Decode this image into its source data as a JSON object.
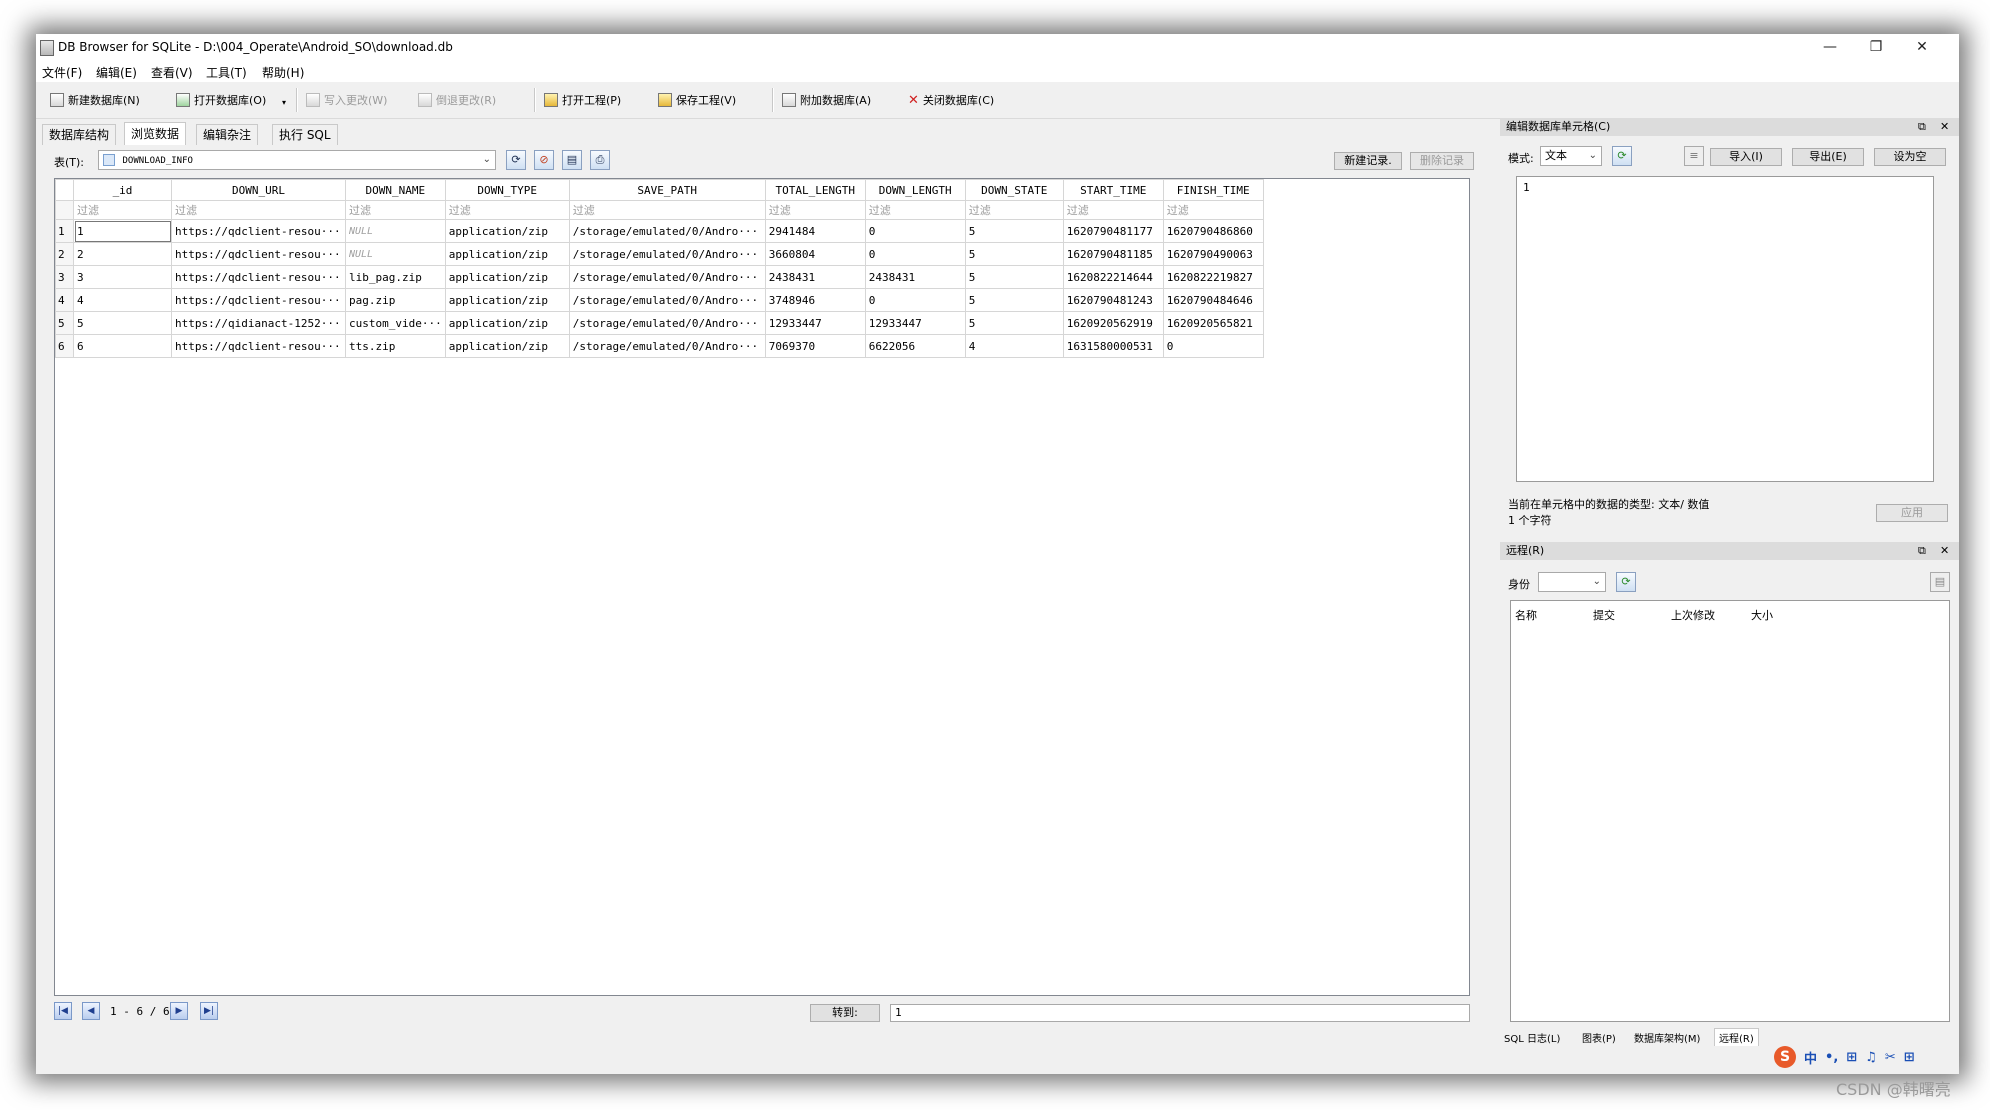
{
  "window": {
    "title": "DB Browser for SQLite - D:\\004_Operate\\Android_SO\\download.db",
    "controls": {
      "minimize": "—",
      "restore": "❐",
      "close": "✕"
    }
  },
  "menu": [
    "文件(F)",
    "编辑(E)",
    "查看(V)",
    "工具(T)",
    "帮助(H)"
  ],
  "toolbar": {
    "new_db": "新建数据库(N)",
    "open_db": "打开数据库(O)",
    "write_changes": "写入更改(W)",
    "revert_changes": "倒退更改(R)",
    "open_project": "打开工程(P)",
    "save_project": "保存工程(V)",
    "attach_db": "附加数据库(A)",
    "close_db": "关闭数据库(C)"
  },
  "tabs": [
    "数据库结构",
    "浏览数据",
    "编辑杂注",
    "执行 SQL"
  ],
  "browse": {
    "table_label": "表(T):",
    "table_selected": "DOWNLOAD_INFO",
    "new_record": "新建记录.",
    "delete_record": "删除记录",
    "columns": [
      "_id",
      "DOWN_URL",
      "DOWN_NAME",
      "DOWN_TYPE",
      "SAVE_PATH",
      "TOTAL_LENGTH",
      "DOWN_LENGTH",
      "DOWN_STATE",
      "START_TIME",
      "FINISH_TIME"
    ],
    "filter_placeholder": "过滤",
    "rows": [
      [
        "1",
        "1",
        "https://qdclient-resou···",
        "NULL",
        "application/zip",
        "/storage/emulated/0/Andro···",
        "2941484",
        "0",
        "5",
        "1620790481177",
        "1620790486860"
      ],
      [
        "2",
        "2",
        "https://qdclient-resou···",
        "NULL",
        "application/zip",
        "/storage/emulated/0/Andro···",
        "3660804",
        "0",
        "5",
        "1620790481185",
        "1620790490063"
      ],
      [
        "3",
        "3",
        "https://qdclient-resou···",
        "lib_pag.zip",
        "application/zip",
        "/storage/emulated/0/Andro···",
        "2438431",
        "2438431",
        "5",
        "1620822214644",
        "1620822219827"
      ],
      [
        "4",
        "4",
        "https://qdclient-resou···",
        "pag.zip",
        "application/zip",
        "/storage/emulated/0/Andro···",
        "3748946",
        "0",
        "5",
        "1620790481243",
        "1620790484646"
      ],
      [
        "5",
        "5",
        "https://qidianact-1252···",
        "custom_vide···",
        "application/zip",
        "/storage/emulated/0/Andro···",
        "12933447",
        "12933447",
        "5",
        "1620920562919",
        "1620920565821"
      ],
      [
        "6",
        "6",
        "https://qdclient-resou···",
        "tts.zip",
        "application/zip",
        "/storage/emulated/0/Andro···",
        "7069370",
        "6622056",
        "4",
        "1631580000531",
        "0"
      ]
    ],
    "pager": "1 - 6 / 6",
    "goto_label": "转到:",
    "goto_value": "1"
  },
  "edit_cell": {
    "title": "编辑数据库单元格(C)",
    "mode_label": "模式:",
    "mode_value": "文本",
    "import": "导入(I)",
    "export": "导出(E)",
    "set_null": "设为空",
    "content": "1",
    "type_info": "当前在单元格中的数据的类型: 文本/ 数值",
    "size_info": "1 个字符",
    "apply": "应用"
  },
  "remote": {
    "title": "远程(R)",
    "identity_label": "身份",
    "columns": [
      "名称",
      "提交",
      "上次修改",
      "大小"
    ]
  },
  "bottom_tabs": [
    "SQL 日志(L)",
    "图表(P)",
    "数据库架构(M)",
    "远程(R)"
  ],
  "ime": {
    "logo": "S",
    "items": [
      "中",
      "•,",
      "⊞",
      "♫",
      "✂",
      "⊞"
    ]
  },
  "watermark": "CSDN @韩曙亮"
}
